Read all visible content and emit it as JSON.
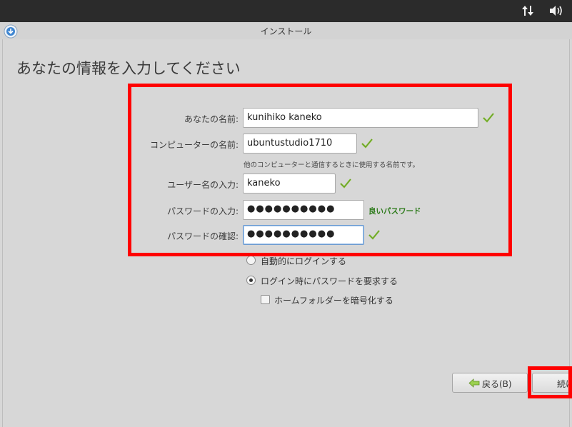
{
  "topbar": {
    "network_icon": "network-transfer-icon",
    "volume_icon": "volume-icon"
  },
  "window": {
    "title": "インストール",
    "app_icon": "installer-download-icon"
  },
  "heading": "あなたの情報を入力してください",
  "form": {
    "name": {
      "label": "あなたの名前:",
      "value": "kunihiko kaneko",
      "valid": true
    },
    "computer": {
      "label": "コンピューターの名前:",
      "value": "ubuntustudio1710",
      "valid": true,
      "hint": "他のコンピューターと通信するときに使用する名前です。"
    },
    "username": {
      "label": "ユーザー名の入力:",
      "value": "kaneko",
      "valid": true
    },
    "password": {
      "label": "パスワードの入力:",
      "value": "●●●●●●●●●●",
      "strength": "良いパスワード"
    },
    "confirm": {
      "label": "パスワードの確認:",
      "value": "●●●●●●●●●●",
      "valid": true
    }
  },
  "options": {
    "auto_login": {
      "label": "自動的にログインする",
      "selected": false
    },
    "require_password": {
      "label": "ログイン時にパスワードを要求する",
      "selected": true
    },
    "encrypt_home": {
      "label": "ホームフォルダーを暗号化する",
      "checked": false
    }
  },
  "buttons": {
    "back": "戻る(B)",
    "continue": "続け"
  },
  "colors": {
    "highlight": "#ff0000",
    "check_green": "#8cc63f",
    "strength_text": "#2c7a1a"
  }
}
